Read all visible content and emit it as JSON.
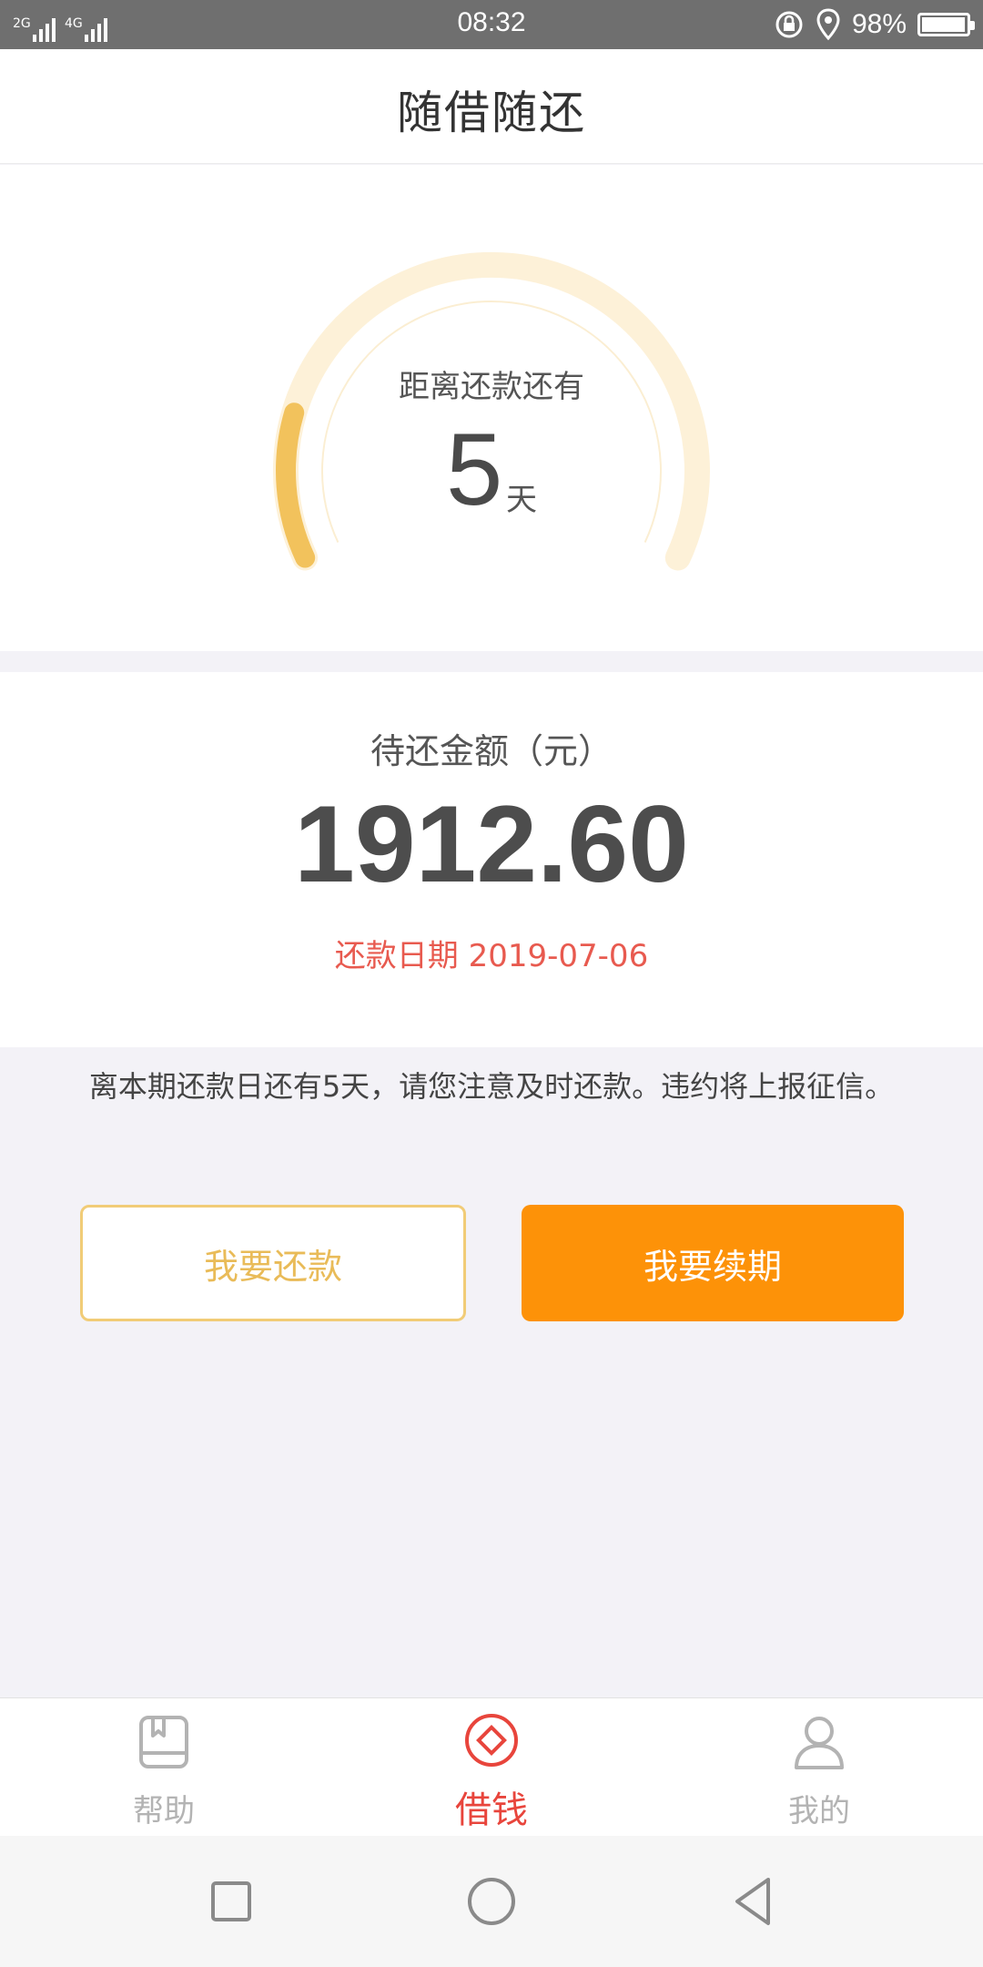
{
  "status_bar": {
    "network_1": "2G",
    "network_2": "4G",
    "time": "08:32",
    "battery_text": "98%",
    "battery_level": 0.98
  },
  "header": {
    "title": "随借随还"
  },
  "countdown": {
    "label": "距离还款还有",
    "days": "5",
    "unit": "天",
    "progress_fraction": 0.18,
    "progress_color": "#f2c25c",
    "track_color": "#fdf1d8"
  },
  "repayment": {
    "amount_label": "待还金额（元）",
    "amount": "1912.60",
    "due_date": "还款日期 2019-07-06",
    "due_color": "#e85a4f"
  },
  "notice": "离本期还款日还有5天，请您注意及时还款。违约将上报征信。",
  "buttons": {
    "repay_label": "我要还款",
    "renew_label": "我要续期",
    "renew_color": "#fd9208"
  },
  "tabbar": {
    "items": [
      {
        "label": "帮助",
        "icon": "book-icon",
        "active": false
      },
      {
        "label": "借钱",
        "icon": "diamond-circle-icon",
        "active": true
      },
      {
        "label": "我的",
        "icon": "person-icon",
        "active": false
      }
    ],
    "active_color": "#e8453c"
  },
  "navbar": {
    "icons": [
      "square-icon",
      "circle-icon",
      "back-triangle-icon"
    ]
  }
}
